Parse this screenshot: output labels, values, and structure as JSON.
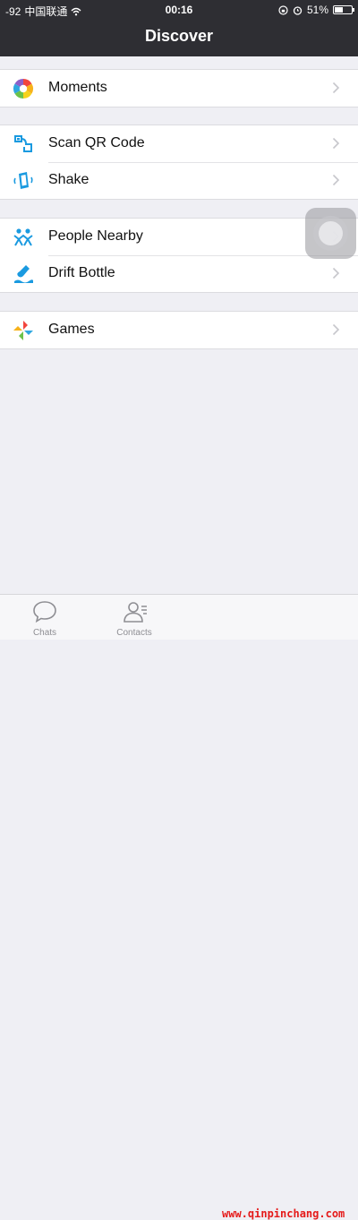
{
  "status_bar": {
    "signal": "-92",
    "carrier": "中国联通",
    "time": "00:16",
    "battery": "51%",
    "battery_level": 0.51
  },
  "header": {
    "title": "Discover"
  },
  "groups": [
    {
      "items": [
        {
          "label": "Moments",
          "icon": "moments-icon"
        }
      ]
    },
    {
      "items": [
        {
          "label": "Scan QR Code",
          "icon": "scan-qr-icon"
        },
        {
          "label": "Shake",
          "icon": "shake-icon"
        }
      ]
    },
    {
      "items": [
        {
          "label": "People Nearby",
          "icon": "people-nearby-icon"
        },
        {
          "label": "Drift Bottle",
          "icon": "drift-bottle-icon"
        }
      ]
    },
    {
      "items": [
        {
          "label": "Games",
          "icon": "games-icon"
        }
      ]
    }
  ],
  "tabbar": {
    "tabs": [
      {
        "label": "Chats",
        "icon": "chat-bubble-icon"
      },
      {
        "label": "Contacts",
        "icon": "contacts-icon"
      }
    ]
  },
  "watermark": "www.qinpinchang.com",
  "colors": {
    "header_bg": "#2e2e33",
    "page_bg": "#efeff4",
    "tab_gray": "#8e8e93",
    "icon_blue": "#1a9ae0"
  }
}
